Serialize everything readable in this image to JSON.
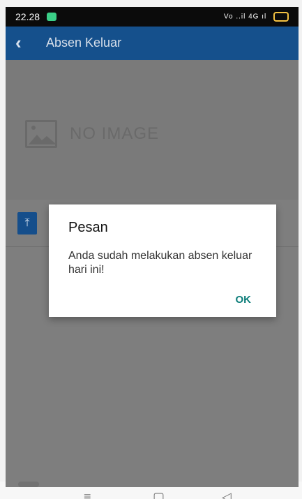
{
  "status_bar": {
    "time": "22.28",
    "signal_text": "Vo ..il 4G ıl",
    "notification_color": "#3bcf87",
    "battery_color": "#f4c242"
  },
  "app_bar": {
    "title": "Absen Keluar",
    "back_icon": "chevron-left-icon",
    "background": "#15508c"
  },
  "content": {
    "no_image_text": "NO IMAGE",
    "image_placeholder_icon": "image-icon",
    "upload_icon": "upload-icon"
  },
  "dialog": {
    "title": "Pesan",
    "message": "Anda sudah melakukan absen keluar hari ini!",
    "ok_label": "OK",
    "ok_color": "#0c7d79"
  },
  "navbar": {
    "menu_icon": "menu-icon",
    "home_icon": "home-icon",
    "back_icon": "back-triangle-icon"
  }
}
